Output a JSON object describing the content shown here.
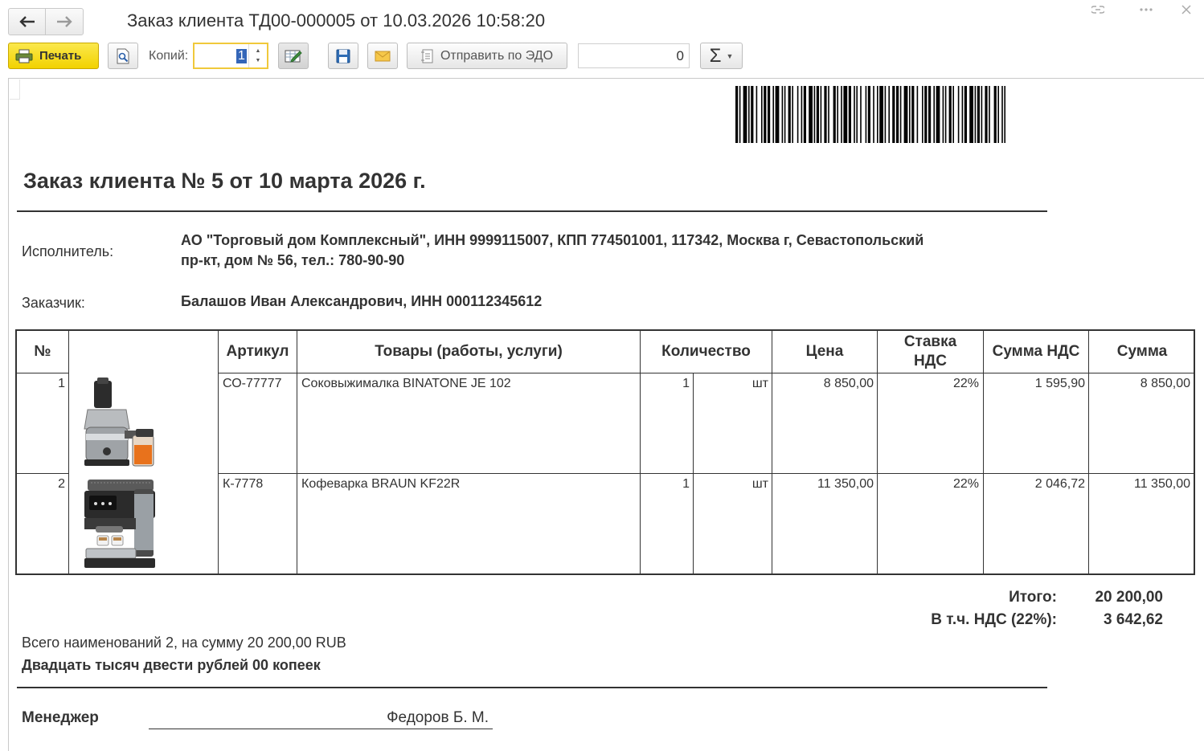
{
  "window": {
    "title": "Заказ клиента ТД00-000005 от 10.03.2026 10:58:20"
  },
  "toolbar": {
    "print_label": "Печать",
    "copies_label": "Копий:",
    "copies_value": "1",
    "send_edo_label": "Отправить по ЭДО",
    "sum_value": "0",
    "sigma_label": "Σ"
  },
  "document": {
    "title": "Заказ клиента № 5 от 10 марта 2026 г.",
    "executor_label": "Исполнитель:",
    "executor_line1": "АО \"Торговый дом Комплексный\", ИНН 9999115007, КПП 774501001, 117342, Москва г, Севастопольский",
    "executor_line2": "пр-кт, дом № 56, тел.: 780-90-90",
    "customer_label": "Заказчик:",
    "customer_value": "Балашов Иван Александрович, ИНН 000112345612",
    "table": {
      "headers": {
        "num": "№",
        "article": "Артикул",
        "goods": "Товары (работы, услуги)",
        "qty": "Количество",
        "price": "Цена",
        "vat_rate_line1": "Ставка",
        "vat_rate_line2": "НДС",
        "vat_sum": "Сумма НДС",
        "sum": "Сумма"
      },
      "rows": [
        {
          "num": "1",
          "article": "СО-77777",
          "name": "Соковыжималка  BINATONE JE 102",
          "qty": "1",
          "unit": "шт",
          "price": "8 850,00",
          "vat_rate": "22%",
          "vat_sum": "1 595,90",
          "sum": "8 850,00"
        },
        {
          "num": "2",
          "article": "К-7778",
          "name": "Кофеварка BRAUN KF22R",
          "qty": "1",
          "unit": "шт",
          "price": "11 350,00",
          "vat_rate": "22%",
          "vat_sum": "2 046,72",
          "sum": "11 350,00"
        }
      ]
    },
    "totals": {
      "total_label": "Итого:",
      "total_value": "20 200,00",
      "vat_label": "В т.ч. НДС (22%):",
      "vat_value": "3 642,62"
    },
    "summary_line": "Всего наименований 2, на сумму 20 200,00 RUB",
    "amount_in_words": "Двадцать тысяч двести рублей 00 копеек",
    "manager_label": "Менеджер",
    "manager_name": "Федоров Б. М."
  },
  "colors": {
    "print_button": "#f2d200",
    "copies_border": "#f0c93b",
    "selection": "#3466b8"
  },
  "icons": [
    "arrow-left-icon",
    "arrow-right-icon",
    "link-icon",
    "more-icon",
    "close-icon",
    "printer-icon",
    "preview-icon",
    "edit-table-icon",
    "floppy-save-icon",
    "envelope-icon",
    "edo-send-icon",
    "sigma-icon"
  ]
}
